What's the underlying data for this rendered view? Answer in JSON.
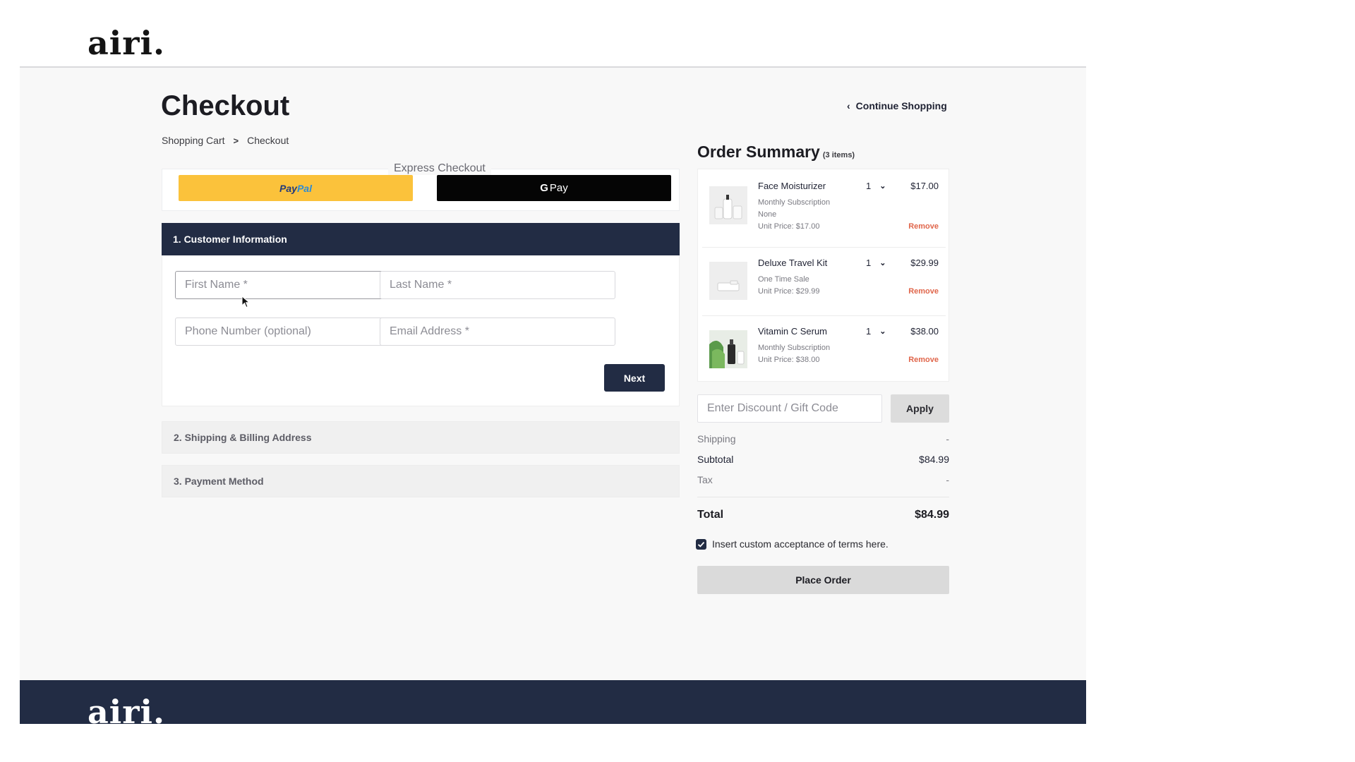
{
  "brand": {
    "logo_text": "airi."
  },
  "page": {
    "title": "Checkout",
    "continue_label": "Continue Shopping"
  },
  "breadcrumb": {
    "items": [
      "Shopping Cart",
      "Checkout"
    ],
    "separator": ">"
  },
  "express": {
    "label": "Express Checkout",
    "paypal_a": "Pay",
    "paypal_b": "Pal",
    "gpay_g": "G",
    "gpay_text": "Pay"
  },
  "customer": {
    "header": "1. Customer Information",
    "first_name_placeholder": "First Name *",
    "last_name_placeholder": "Last Name *",
    "phone_placeholder": "Phone Number (optional)",
    "email_placeholder": "Email Address *",
    "next_label": "Next"
  },
  "sections": {
    "shipping": "2. Shipping & Billing Address",
    "payment": "3. Payment Method"
  },
  "summary": {
    "title": "Order Summary",
    "count": "(3 items)",
    "items": [
      {
        "name": "Face Moisturizer",
        "line1": "Monthly Subscription",
        "line2": "None",
        "unit": "Unit Price: $17.00",
        "qty": "1",
        "price": "$17.00",
        "remove": "Remove"
      },
      {
        "name": "Deluxe Travel Kit",
        "line1": "One Time Sale",
        "unit": "Unit Price: $29.99",
        "qty": "1",
        "price": "$29.99",
        "remove": "Remove"
      },
      {
        "name": "Vitamin C Serum",
        "line1": "Monthly Subscription",
        "unit": "Unit Price: $38.00",
        "qty": "1",
        "price": "$38.00",
        "remove": "Remove"
      }
    ],
    "discount_placeholder": "Enter Discount / Gift Code",
    "apply_label": "Apply",
    "shipping_label": "Shipping",
    "shipping_value": "-",
    "subtotal_label": "Subtotal",
    "subtotal_value": "$84.99",
    "tax_label": "Tax",
    "tax_value": "-",
    "total_label": "Total",
    "total_value": "$84.99",
    "terms_text": "Insert custom acceptance of terms here.",
    "terms_checked": true,
    "place_order_label": "Place Order"
  },
  "colors": {
    "navy": "#222c44",
    "paypal_yellow": "#fbc23b",
    "remove_red": "#e0664b"
  },
  "icons": {
    "back": "chevron-left-icon",
    "breadcrumb_sep": "chevron-right-icon",
    "qty": "chevron-down-icon",
    "cursor": "mouse-cursor-icon",
    "check": "checkmark-icon"
  }
}
